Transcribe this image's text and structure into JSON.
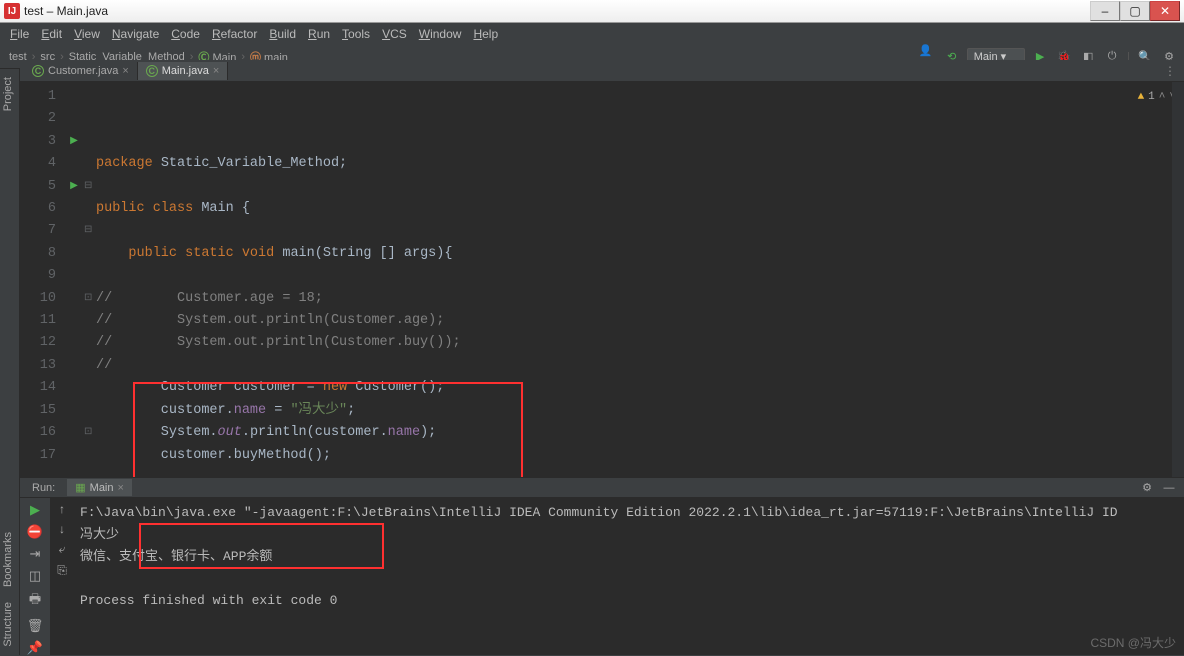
{
  "window": {
    "title": "test – Main.java"
  },
  "menu": [
    "File",
    "Edit",
    "View",
    "Navigate",
    "Code",
    "Refactor",
    "Build",
    "Run",
    "Tools",
    "VCS",
    "Window",
    "Help"
  ],
  "breadcrumb": {
    "project": "test",
    "folder": "src",
    "pkg": "Static_Variable_Method",
    "cls": "Main",
    "method": "main"
  },
  "toolbar": {
    "run_config": "Main"
  },
  "left_sidebar": {
    "project": "Project",
    "bookmarks": "Bookmarks",
    "structure": "Structure"
  },
  "tabs": [
    {
      "name": "Customer.java",
      "active": false
    },
    {
      "name": "Main.java",
      "active": true
    }
  ],
  "editor_status": {
    "warnings": "1"
  },
  "code_lines": [
    {
      "n": 1,
      "marker": "",
      "fold": "",
      "tokens": [
        {
          "t": "package ",
          "c": "kw"
        },
        {
          "t": "Static_Variable_Method;",
          "c": ""
        }
      ]
    },
    {
      "n": 2,
      "marker": "",
      "fold": "",
      "tokens": [
        {
          "t": "",
          "c": ""
        }
      ]
    },
    {
      "n": 3,
      "marker": "▶",
      "fold": "",
      "tokens": [
        {
          "t": "public class ",
          "c": "kw"
        },
        {
          "t": "Main {",
          "c": ""
        }
      ]
    },
    {
      "n": 4,
      "marker": "",
      "fold": "",
      "tokens": [
        {
          "t": "",
          "c": ""
        }
      ]
    },
    {
      "n": 5,
      "marker": "▶",
      "fold": "⊟",
      "tokens": [
        {
          "t": "    public static void ",
          "c": "kw"
        },
        {
          "t": "main(String [] args){",
          "c": ""
        }
      ]
    },
    {
      "n": 6,
      "marker": "",
      "fold": "",
      "tokens": [
        {
          "t": "",
          "c": ""
        }
      ]
    },
    {
      "n": 7,
      "marker": "",
      "fold": "⊟",
      "tokens": [
        {
          "t": "//        Customer.age = 18;",
          "c": "comm"
        }
      ]
    },
    {
      "n": 8,
      "marker": "",
      "fold": "",
      "tokens": [
        {
          "t": "//        System.out.println(Customer.age);",
          "c": "comm"
        }
      ]
    },
    {
      "n": 9,
      "marker": "",
      "fold": "",
      "tokens": [
        {
          "t": "//        System.out.println(Customer.buy());",
          "c": "comm"
        }
      ]
    },
    {
      "n": 10,
      "marker": "",
      "fold": "⊡",
      "tokens": [
        {
          "t": "//",
          "c": "comm"
        }
      ]
    },
    {
      "n": 11,
      "marker": "",
      "fold": "",
      "tokens": [
        {
          "t": "        Customer customer = ",
          "c": ""
        },
        {
          "t": "new ",
          "c": "kw"
        },
        {
          "t": "Customer();",
          "c": ""
        }
      ]
    },
    {
      "n": 12,
      "marker": "",
      "fold": "",
      "tokens": [
        {
          "t": "        customer.",
          "c": ""
        },
        {
          "t": "name",
          "c": "field"
        },
        {
          "t": " = ",
          "c": ""
        },
        {
          "t": "\"冯大少\"",
          "c": "str"
        },
        {
          "t": ";",
          "c": ""
        }
      ]
    },
    {
      "n": 13,
      "marker": "",
      "fold": "",
      "tokens": [
        {
          "t": "        System.",
          "c": ""
        },
        {
          "t": "out",
          "c": "field stat"
        },
        {
          "t": ".println(customer.",
          "c": ""
        },
        {
          "t": "name",
          "c": "field"
        },
        {
          "t": ");",
          "c": ""
        }
      ]
    },
    {
      "n": 14,
      "marker": "",
      "fold": "",
      "tokens": [
        {
          "t": "        customer.buyMethod();",
          "c": ""
        }
      ]
    },
    {
      "n": 15,
      "marker": "",
      "fold": "",
      "tokens": [
        {
          "t": "",
          "c": ""
        }
      ]
    },
    {
      "n": 16,
      "marker": "",
      "fold": "⊡",
      "tokens": [
        {
          "t": "    }",
          "c": ""
        }
      ]
    },
    {
      "n": 17,
      "marker": "",
      "fold": "",
      "tokens": [
        {
          "t": "}",
          "c": ""
        }
      ]
    }
  ],
  "run_panel": {
    "label": "Run:",
    "tab": "Main",
    "output": [
      "F:\\Java\\bin\\java.exe \"-javaagent:F:\\JetBrains\\IntelliJ IDEA Community Edition 2022.2.1\\lib\\idea_rt.jar=57119:F:\\JetBrains\\IntelliJ ID",
      "冯大少",
      "微信、支付宝、银行卡、APP余额",
      "",
      "Process finished with exit code 0"
    ]
  },
  "watermark": "CSDN @冯大少"
}
